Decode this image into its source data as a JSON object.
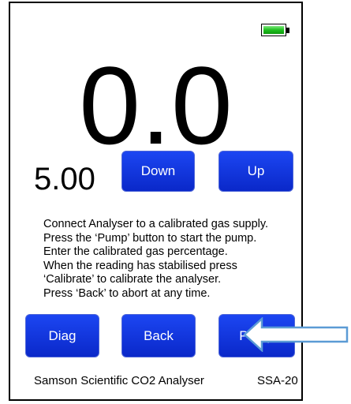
{
  "battery": {
    "icon": "battery-full-icon",
    "level": 1.0,
    "fill_color": "#1fbf1f"
  },
  "reading": {
    "value": "0.0"
  },
  "calibration": {
    "setpoint": "5.00"
  },
  "buttons": {
    "down": "Down",
    "up": "Up",
    "diag": "Diag",
    "back": "Back",
    "pump": "Pump"
  },
  "instructions": [
    "Connect Analyser to a calibrated gas supply.",
    "Press the ‘Pump’ button to start the pump.",
    "Enter the calibrated gas percentage.",
    "When the reading has stabilised press",
    "‘Calibrate’ to calibrate the analyser.",
    "Press ‘Back’ to abort at any time."
  ],
  "footer": {
    "product_name": "Samson Scientific CO2 Analyser",
    "model": "SSA-20"
  },
  "annotation": {
    "icon": "pointer-arrow-icon",
    "color": "#5b9bd5"
  },
  "colors": {
    "button": "#0a28c9",
    "button_text": "#ffffff",
    "border": "#000000"
  }
}
